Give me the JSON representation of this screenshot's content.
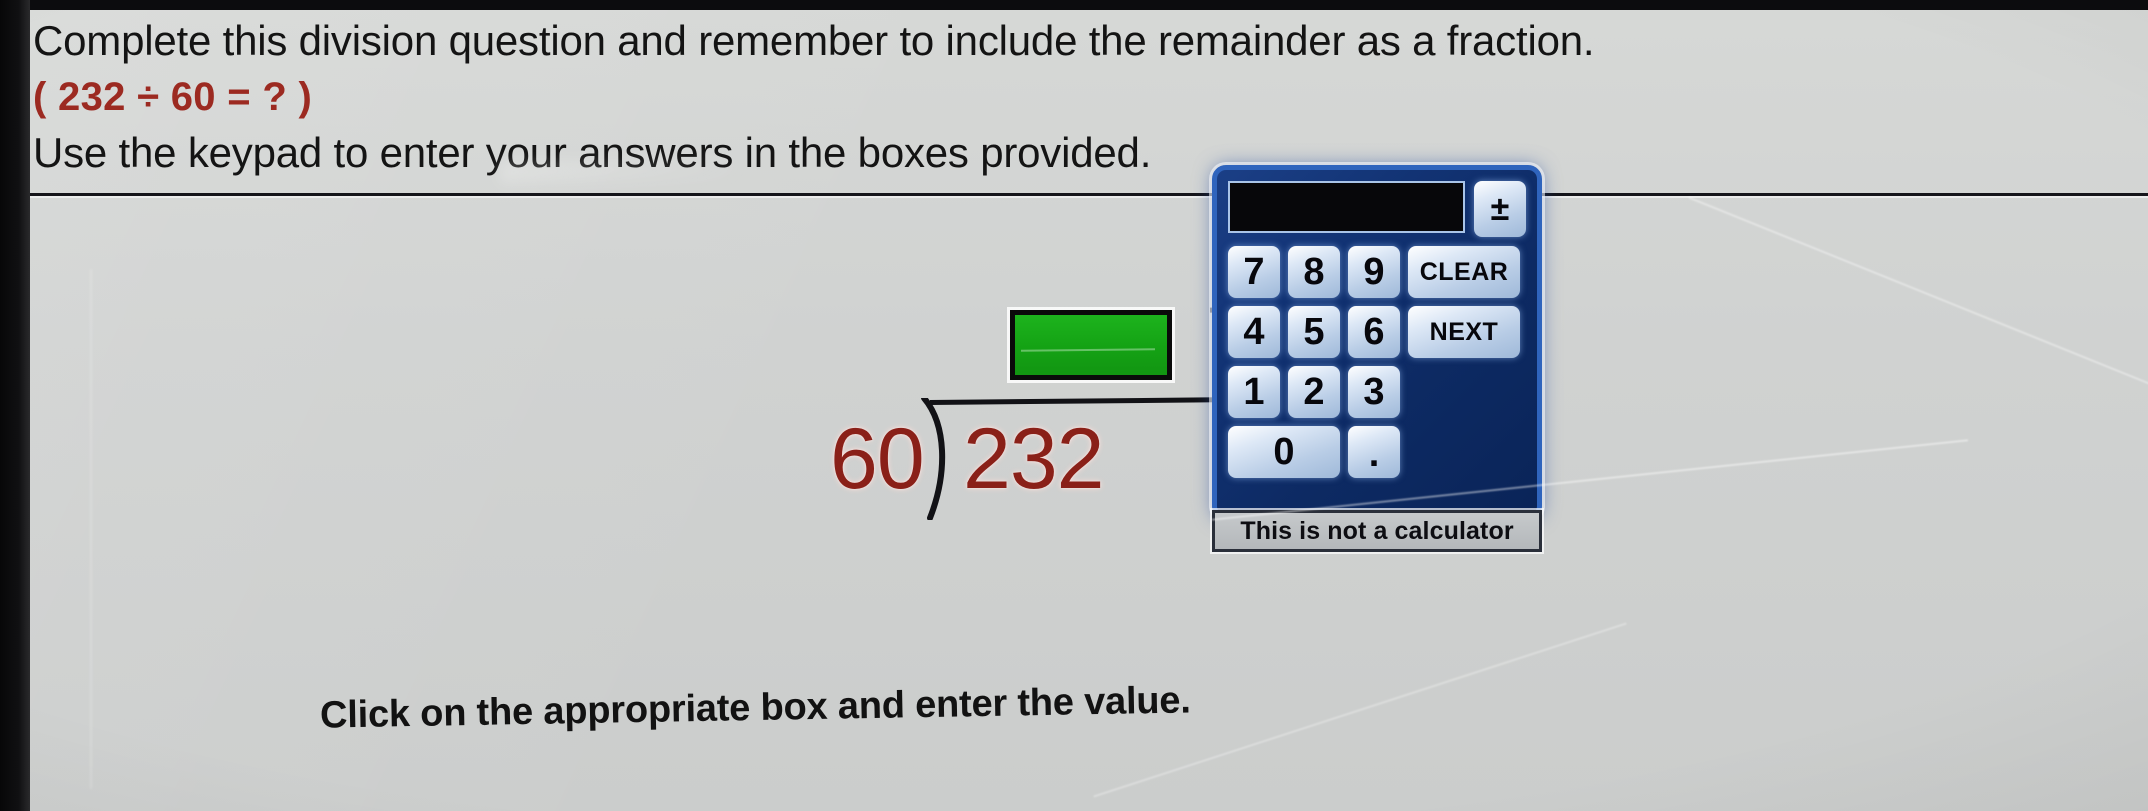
{
  "header": {
    "line1": "Complete this division question and remember to include the remainder as a fraction.",
    "line2": "( 232 ÷ 60 = ? )",
    "line3": "Use the keypad to enter your answers in the boxes provided."
  },
  "problem": {
    "divisor": "60",
    "dividend": "232",
    "quotient_value": "",
    "remainder_numerator": "",
    "remainder_denominator": ""
  },
  "hint": "Click on the appropriate box and enter the value.",
  "keypad": {
    "display_value": "",
    "plus_minus_label": "±",
    "rows": [
      [
        "7",
        "8",
        "9"
      ],
      [
        "4",
        "5",
        "6"
      ],
      [
        "1",
        "2",
        "3"
      ]
    ],
    "zero_label": "0",
    "dot_label": ".",
    "clear_label": "CLEAR",
    "next_label": "NEXT",
    "footer_label": "This is not a calculator"
  },
  "colors": {
    "page_background": "#d0d2d1",
    "header_red": "#9c2a21",
    "numeral_red": "#8a2018",
    "quotient_green": "#14a214",
    "fraction_red": "#8d2318",
    "keypad_blue": "#123374",
    "key_face": "#dde8f6"
  }
}
